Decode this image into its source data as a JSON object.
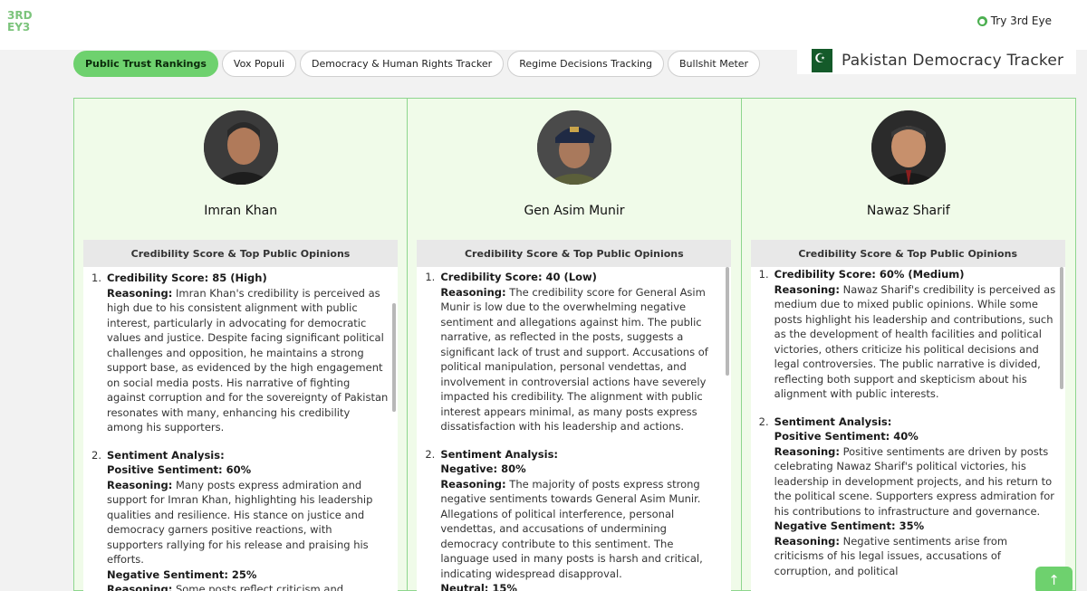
{
  "header": {
    "logo_text": "3RD EY3",
    "try_label": "Try 3rd Eye"
  },
  "tabs": [
    {
      "label": "Public Trust Rankings",
      "active": true
    },
    {
      "label": "Vox Populi",
      "active": false
    },
    {
      "label": "Democracy & Human Rights Tracker",
      "active": false
    },
    {
      "label": "Regime Decisions Tracking",
      "active": false
    },
    {
      "label": "Bullshit Meter",
      "active": false
    }
  ],
  "brand": {
    "title": "Pakistan Democracy Tracker"
  },
  "colors": {
    "accent": "#6ed16e",
    "panel_border": "#8ed68e",
    "panel_bg": "#f0fbe9"
  },
  "politicians": [
    {
      "name": "Imran Khan",
      "card_title": "Credibility Score & Top Public Opinions",
      "items": [
        {
          "num": "1.",
          "lines": [
            {
              "label": "Credibility Score: 85 (High)",
              "text": ""
            },
            {
              "label": "Reasoning:",
              "text": "Imran Khan's credibility is perceived as high due to his consistent alignment with public interest, particularly in advocating for democratic values and justice. Despite facing significant political challenges and opposition, he maintains a strong support base, as evidenced by the high engagement on social media posts. His narrative of fighting against corruption and for the sovereignty of Pakistan resonates with many, enhancing his credibility among his supporters."
            }
          ]
        },
        {
          "num": "2.",
          "lines": [
            {
              "label": "Sentiment Analysis:",
              "text": ""
            },
            {
              "label": "Positive Sentiment: 60%",
              "text": ""
            },
            {
              "label": "Reasoning:",
              "text": "Many posts express admiration and support for Imran Khan, highlighting his leadership qualities and resilience. His stance on justice and democracy garners positive reactions, with supporters rallying for his release and praising his efforts."
            },
            {
              "label": "Negative Sentiment: 25%",
              "text": ""
            },
            {
              "label": "Reasoning:",
              "text": "Some posts reflect criticism and opposition"
            }
          ]
        }
      ]
    },
    {
      "name": "Gen Asim Munir",
      "card_title": "Credibility Score & Top Public Opinions",
      "items": [
        {
          "num": "1.",
          "lines": [
            {
              "label": "Credibility Score: 40 (Low)",
              "text": ""
            },
            {
              "label": "Reasoning:",
              "text": "The credibility score for General Asim Munir is low due to the overwhelming negative sentiment and allegations against him. The public narrative, as reflected in the posts, suggests a significant lack of trust and support. Accusations of political manipulation, personal vendettas, and involvement in controversial actions have severely impacted his credibility. The alignment with public interest appears minimal, as many posts express dissatisfaction with his leadership and actions."
            }
          ]
        },
        {
          "num": "2.",
          "lines": [
            {
              "label": "Sentiment Analysis:",
              "text": ""
            },
            {
              "label": "Negative: 80%",
              "text": ""
            },
            {
              "label": "Reasoning:",
              "text": "The majority of posts express strong negative sentiments towards General Asim Munir. Allegations of political interference, personal vendettas, and accusations of undermining democracy contribute to this sentiment. The language used in many posts is harsh and critical, indicating widespread disapproval."
            },
            {
              "label": "Neutral: 15%",
              "text": ""
            }
          ]
        }
      ]
    },
    {
      "name": "Nawaz Sharif",
      "card_title": "Credibility Score & Top Public Opinions",
      "items": [
        {
          "num": "1.",
          "lines": [
            {
              "label": "Credibility Score: 60% (Medium)",
              "text": ""
            },
            {
              "label": "Reasoning:",
              "text": "Nawaz Sharif's credibility is perceived as medium due to mixed public opinions. While some posts highlight his leadership and contributions, such as the development of health facilities and political victories, others criticize his political decisions and legal controversies. The public narrative is divided, reflecting both support and skepticism about his alignment with public interests."
            }
          ]
        },
        {
          "num": "2.",
          "lines": [
            {
              "label": "Sentiment Analysis:",
              "text": ""
            },
            {
              "label": "Positive Sentiment: 40%",
              "text": ""
            },
            {
              "label": "Reasoning:",
              "text": "Positive sentiments are driven by posts celebrating Nawaz Sharif's political victories, his leadership in development projects, and his return to the political scene. Supporters express admiration for his contributions to infrastructure and governance."
            },
            {
              "label": "Negative Sentiment: 35%",
              "text": ""
            },
            {
              "label": "Reasoning:",
              "text": "Negative sentiments arise from criticisms of his legal issues, accusations of corruption, and political"
            }
          ]
        }
      ]
    }
  ],
  "scroll_top_icon": "arrow-up-icon"
}
